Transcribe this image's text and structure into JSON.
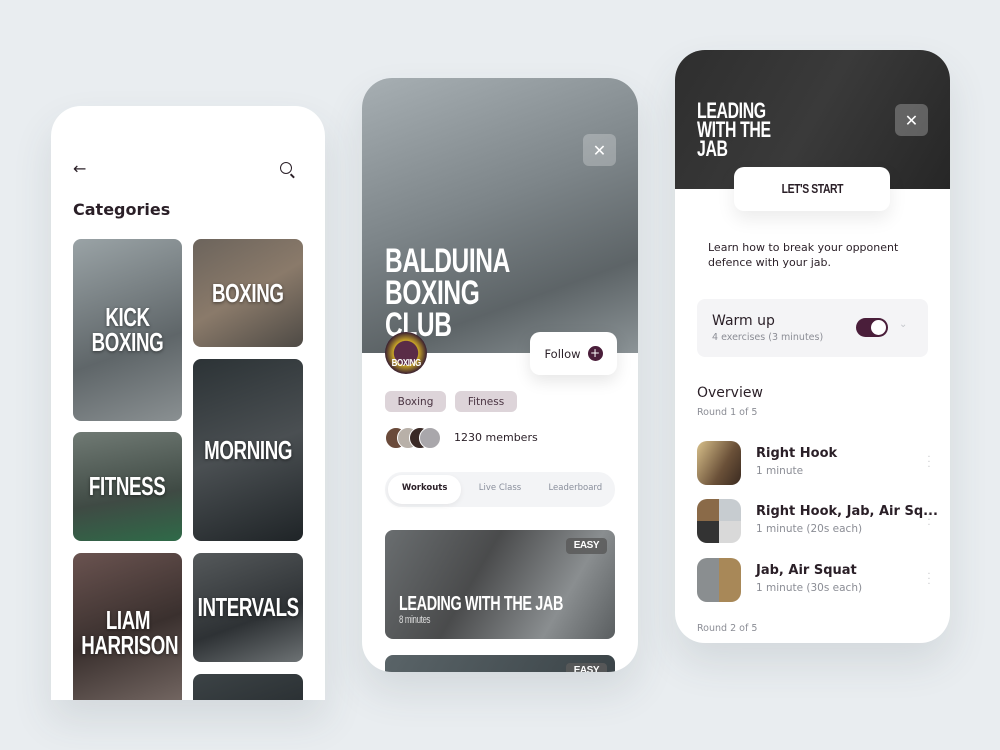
{
  "colors": {
    "accent": "#4a1e3a",
    "tag_bg": "#ddd4d9",
    "background": "#e9edf0"
  },
  "categories_screen": {
    "back_icon": "arrow-left-icon",
    "search_icon": "search-icon",
    "title": "Categories",
    "tiles": [
      {
        "label": "Kick Boxing"
      },
      {
        "label": "Boxing"
      },
      {
        "label": "Fitness"
      },
      {
        "label": "Morning"
      },
      {
        "label": "Liam Harrison"
      },
      {
        "label": "Intervals"
      },
      {
        "label": ""
      }
    ]
  },
  "club_screen": {
    "title": "Balduina Boxing Club",
    "logo_text": "BOXING",
    "follow_label": "Follow",
    "tags": [
      "Boxing",
      "Fitness"
    ],
    "members": "1230 members",
    "tabs": [
      {
        "label": "Workouts",
        "active": true
      },
      {
        "label": "Live Class"
      },
      {
        "label": "Leaderboard"
      }
    ],
    "workouts": [
      {
        "title": "Leading with the jab",
        "duration": "8 minutes",
        "level": "Easy"
      },
      {
        "title": "",
        "duration": "",
        "level": "Easy"
      }
    ]
  },
  "workout_screen": {
    "title": "Leading with the jab",
    "start_label": "Let's start",
    "description": "Learn how to break your opponent defence with your jab.",
    "warmup": {
      "title": "Warm up",
      "subtitle": "4 exercises (3 minutes)",
      "enabled": true
    },
    "overview_title": "Overview",
    "round1": "Round 1 of 5",
    "exercises": [
      {
        "name": "Right Hook",
        "duration": "1 minute"
      },
      {
        "name": "Right Hook, Jab, Air Sq...",
        "duration": "1 minute (20s each)"
      },
      {
        "name": "Jab, Air Squat",
        "duration": "1 minute (30s each)"
      }
    ],
    "round2": "Round 2 of 5"
  }
}
